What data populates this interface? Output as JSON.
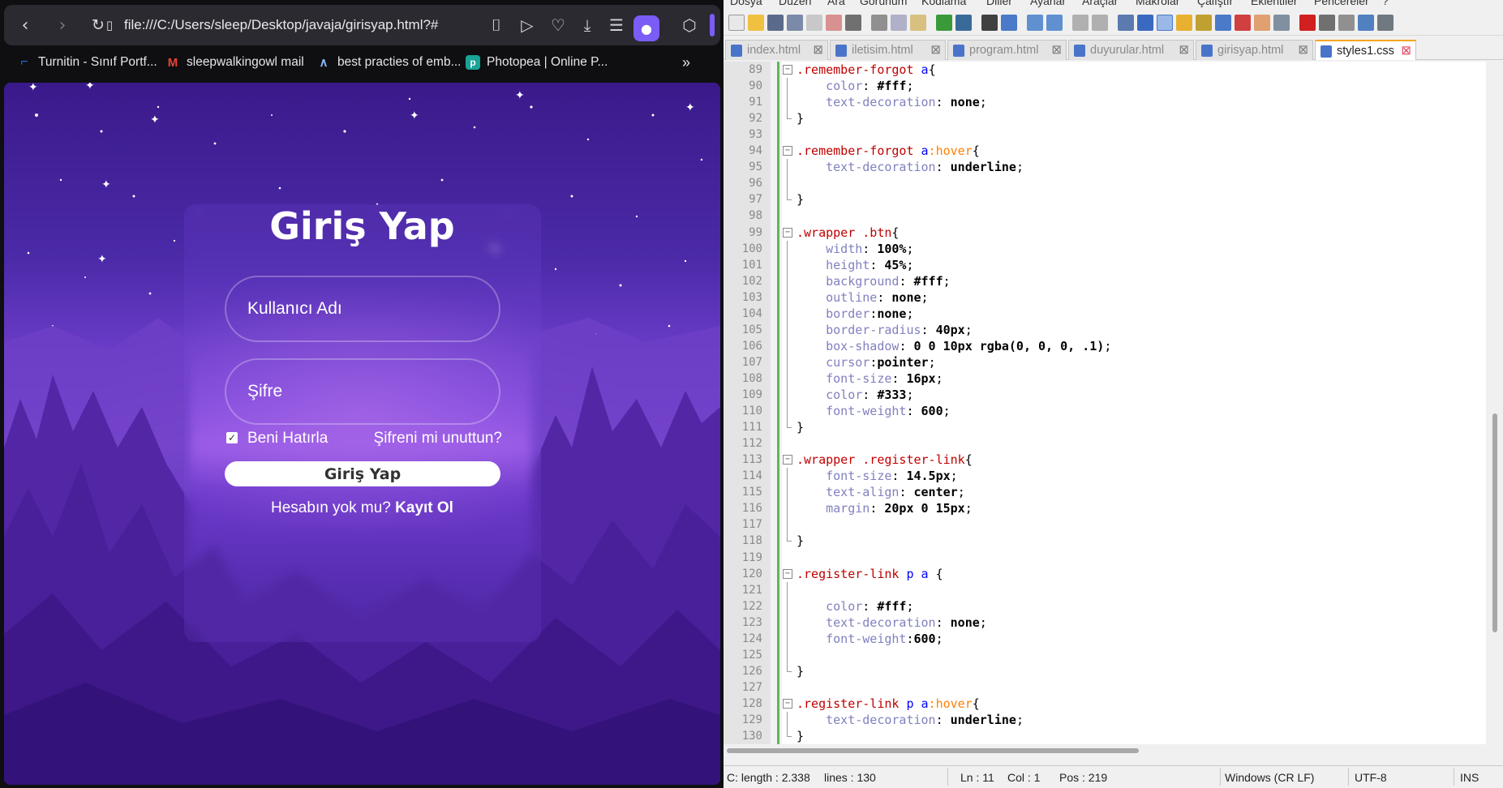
{
  "browser": {
    "url": "file:///C:/Users/sleep/Desktop/javaja/girisyap.html?#",
    "bookmarks": [
      {
        "label": "Turnitin - Sınıf Portf...",
        "icon": "turnitin-icon",
        "color": "#1e6fd9"
      },
      {
        "label": "sleepwalkingowl mail",
        "icon": "gmail-icon",
        "color": "#ea4335"
      },
      {
        "label": "best practies of emb...",
        "icon": "drafting-compass-icon",
        "color": "#8ab4f8"
      },
      {
        "label": "Photopea | Online P...",
        "icon": "photopea-icon",
        "color": "#18a497"
      }
    ],
    "more_bookmarks": "»"
  },
  "login": {
    "title": "Giriş Yap",
    "username_placeholder": "Kullanıcı Adı",
    "password_placeholder": "Şifre",
    "remember_label": "Beni Hatırla",
    "remember_checked": true,
    "forgot_label": "Şifreni mi unuttun?",
    "submit_label": "Giriş Yap",
    "register_prompt": "Hesabın yok mu?",
    "register_link": "Kayıt Ol"
  },
  "editor": {
    "menu": [
      "Dosya",
      "Düzen",
      "Ara",
      "Görünüm",
      "Kodlama",
      "Diller",
      "Ayarlar",
      "Araçlar",
      "Makrolar",
      "Çalıştır",
      "Eklentiler",
      "Pencereler",
      "?"
    ],
    "tabs": [
      {
        "label": "index.html",
        "active": false
      },
      {
        "label": "iletisim.html",
        "active": false
      },
      {
        "label": "program.html",
        "active": false
      },
      {
        "label": "duyurular.html",
        "active": false
      },
      {
        "label": "girisyap.html",
        "active": false
      },
      {
        "label": "styles1.css",
        "active": true
      }
    ],
    "status": {
      "length": "C: length : 2.338",
      "lines": "lines : 130",
      "ln": "Ln : 11",
      "col": "Col : 1",
      "pos": "Pos : 219",
      "eol": "Windows (CR LF)",
      "encoding": "UTF-8",
      "mode": "INS"
    },
    "code_lines": [
      {
        "n": "89",
        "fold": "start",
        "parts": [
          [
            ".remember-forgot",
            "sel"
          ],
          [
            " a",
            "tag"
          ],
          [
            "{",
            "br"
          ]
        ]
      },
      {
        "n": "90",
        "fold": "mid",
        "parts": [
          [
            "    color",
            "prop"
          ],
          [
            ": ",
            "br"
          ],
          [
            "#fff",
            "val"
          ],
          [
            ";",
            "br"
          ]
        ]
      },
      {
        "n": "91",
        "fold": "mid",
        "parts": [
          [
            "    text-decoration",
            "prop"
          ],
          [
            ": ",
            "br"
          ],
          [
            "none",
            "val"
          ],
          [
            ";",
            "br"
          ]
        ]
      },
      {
        "n": "92",
        "fold": "end",
        "parts": [
          [
            "}",
            "br"
          ]
        ]
      },
      {
        "n": "93",
        "fold": "",
        "parts": []
      },
      {
        "n": "94",
        "fold": "start",
        "parts": [
          [
            ".remember-forgot",
            "sel"
          ],
          [
            " a",
            "tag"
          ],
          [
            ":hover",
            "ps"
          ],
          [
            "{",
            "br"
          ]
        ]
      },
      {
        "n": "95",
        "fold": "mid",
        "parts": [
          [
            "    text-decoration",
            "prop"
          ],
          [
            ": ",
            "br"
          ],
          [
            "underline",
            "val"
          ],
          [
            ";",
            "br"
          ]
        ]
      },
      {
        "n": "96",
        "fold": "mid",
        "parts": []
      },
      {
        "n": "97",
        "fold": "end",
        "parts": [
          [
            "}",
            "br"
          ]
        ]
      },
      {
        "n": "98",
        "fold": "",
        "parts": []
      },
      {
        "n": "99",
        "fold": "start",
        "parts": [
          [
            ".wrapper",
            "sel"
          ],
          [
            " .btn",
            "sel"
          ],
          [
            "{",
            "br"
          ]
        ]
      },
      {
        "n": "100",
        "fold": "mid",
        "parts": [
          [
            "    width",
            "prop"
          ],
          [
            ": ",
            "br"
          ],
          [
            "100%",
            "val"
          ],
          [
            ";",
            "br"
          ]
        ]
      },
      {
        "n": "101",
        "fold": "mid",
        "parts": [
          [
            "    height",
            "prop"
          ],
          [
            ": ",
            "br"
          ],
          [
            "45%",
            "val"
          ],
          [
            ";",
            "br"
          ]
        ]
      },
      {
        "n": "102",
        "fold": "mid",
        "parts": [
          [
            "    background",
            "prop"
          ],
          [
            ": ",
            "br"
          ],
          [
            "#fff",
            "val"
          ],
          [
            ";",
            "br"
          ]
        ]
      },
      {
        "n": "103",
        "fold": "mid",
        "parts": [
          [
            "    outline",
            "prop"
          ],
          [
            ": ",
            "br"
          ],
          [
            "none",
            "val"
          ],
          [
            ";",
            "br"
          ]
        ]
      },
      {
        "n": "104",
        "fold": "mid",
        "parts": [
          [
            "    border",
            "prop"
          ],
          [
            ":",
            "br"
          ],
          [
            "none",
            "val"
          ],
          [
            ";",
            "br"
          ]
        ]
      },
      {
        "n": "105",
        "fold": "mid",
        "parts": [
          [
            "    border-radius",
            "prop"
          ],
          [
            ": ",
            "br"
          ],
          [
            "40px",
            "val"
          ],
          [
            ";",
            "br"
          ]
        ]
      },
      {
        "n": "106",
        "fold": "mid",
        "parts": [
          [
            "    box-shadow",
            "prop"
          ],
          [
            ": ",
            "br"
          ],
          [
            "0 0 10px rgba(0, 0, 0, .1)",
            "val"
          ],
          [
            ";",
            "br"
          ]
        ]
      },
      {
        "n": "107",
        "fold": "mid",
        "parts": [
          [
            "    cursor",
            "prop"
          ],
          [
            ":",
            "br"
          ],
          [
            "pointer",
            "val"
          ],
          [
            ";",
            "br"
          ]
        ]
      },
      {
        "n": "108",
        "fold": "mid",
        "parts": [
          [
            "    font-size",
            "prop"
          ],
          [
            ": ",
            "br"
          ],
          [
            "16px",
            "val"
          ],
          [
            ";",
            "br"
          ]
        ]
      },
      {
        "n": "109",
        "fold": "mid",
        "parts": [
          [
            "    color",
            "prop"
          ],
          [
            ": ",
            "br"
          ],
          [
            "#333",
            "val"
          ],
          [
            ";",
            "br"
          ]
        ]
      },
      {
        "n": "110",
        "fold": "mid",
        "parts": [
          [
            "    font-weight",
            "prop"
          ],
          [
            ": ",
            "br"
          ],
          [
            "600",
            "val"
          ],
          [
            ";",
            "br"
          ]
        ]
      },
      {
        "n": "111",
        "fold": "end",
        "parts": [
          [
            "}",
            "br"
          ]
        ]
      },
      {
        "n": "112",
        "fold": "",
        "parts": []
      },
      {
        "n": "113",
        "fold": "start",
        "parts": [
          [
            ".wrapper",
            "sel"
          ],
          [
            " .register-link",
            "sel"
          ],
          [
            "{",
            "br"
          ]
        ]
      },
      {
        "n": "114",
        "fold": "mid",
        "parts": [
          [
            "    font-size",
            "prop"
          ],
          [
            ": ",
            "br"
          ],
          [
            "14.5px",
            "val"
          ],
          [
            ";",
            "br"
          ]
        ]
      },
      {
        "n": "115",
        "fold": "mid",
        "parts": [
          [
            "    text-align",
            "prop"
          ],
          [
            ": ",
            "br"
          ],
          [
            "center",
            "val"
          ],
          [
            ";",
            "br"
          ]
        ]
      },
      {
        "n": "116",
        "fold": "mid",
        "parts": [
          [
            "    margin",
            "prop"
          ],
          [
            ": ",
            "br"
          ],
          [
            "20px 0 15px",
            "val"
          ],
          [
            ";",
            "br"
          ]
        ]
      },
      {
        "n": "117",
        "fold": "mid",
        "parts": []
      },
      {
        "n": "118",
        "fold": "end",
        "parts": [
          [
            "}",
            "br"
          ]
        ]
      },
      {
        "n": "119",
        "fold": "",
        "parts": []
      },
      {
        "n": "120",
        "fold": "start",
        "parts": [
          [
            ".register-link",
            "sel"
          ],
          [
            " p a",
            "tag"
          ],
          [
            " {",
            "br"
          ]
        ]
      },
      {
        "n": "121",
        "fold": "mid",
        "parts": []
      },
      {
        "n": "122",
        "fold": "mid",
        "parts": [
          [
            "    color",
            "prop"
          ],
          [
            ": ",
            "br"
          ],
          [
            "#fff",
            "val"
          ],
          [
            ";",
            "br"
          ]
        ]
      },
      {
        "n": "123",
        "fold": "mid",
        "parts": [
          [
            "    text-decoration",
            "prop"
          ],
          [
            ": ",
            "br"
          ],
          [
            "none",
            "val"
          ],
          [
            ";",
            "br"
          ]
        ]
      },
      {
        "n": "124",
        "fold": "mid",
        "parts": [
          [
            "    font-weight",
            "prop"
          ],
          [
            ":",
            "br"
          ],
          [
            "600",
            "val"
          ],
          [
            ";",
            "br"
          ]
        ]
      },
      {
        "n": "125",
        "fold": "mid",
        "parts": []
      },
      {
        "n": "126",
        "fold": "end",
        "parts": [
          [
            "}",
            "br"
          ]
        ]
      },
      {
        "n": "127",
        "fold": "",
        "parts": []
      },
      {
        "n": "128",
        "fold": "start",
        "parts": [
          [
            ".register-link",
            "sel"
          ],
          [
            " p a",
            "tag"
          ],
          [
            ":hover",
            "ps"
          ],
          [
            "{",
            "br"
          ]
        ]
      },
      {
        "n": "129",
        "fold": "mid",
        "parts": [
          [
            "    text-decoration",
            "prop"
          ],
          [
            ": ",
            "br"
          ],
          [
            "underline",
            "val"
          ],
          [
            ";",
            "br"
          ]
        ]
      },
      {
        "n": "130",
        "fold": "end",
        "parts": [
          [
            "}",
            "br"
          ]
        ]
      }
    ]
  }
}
